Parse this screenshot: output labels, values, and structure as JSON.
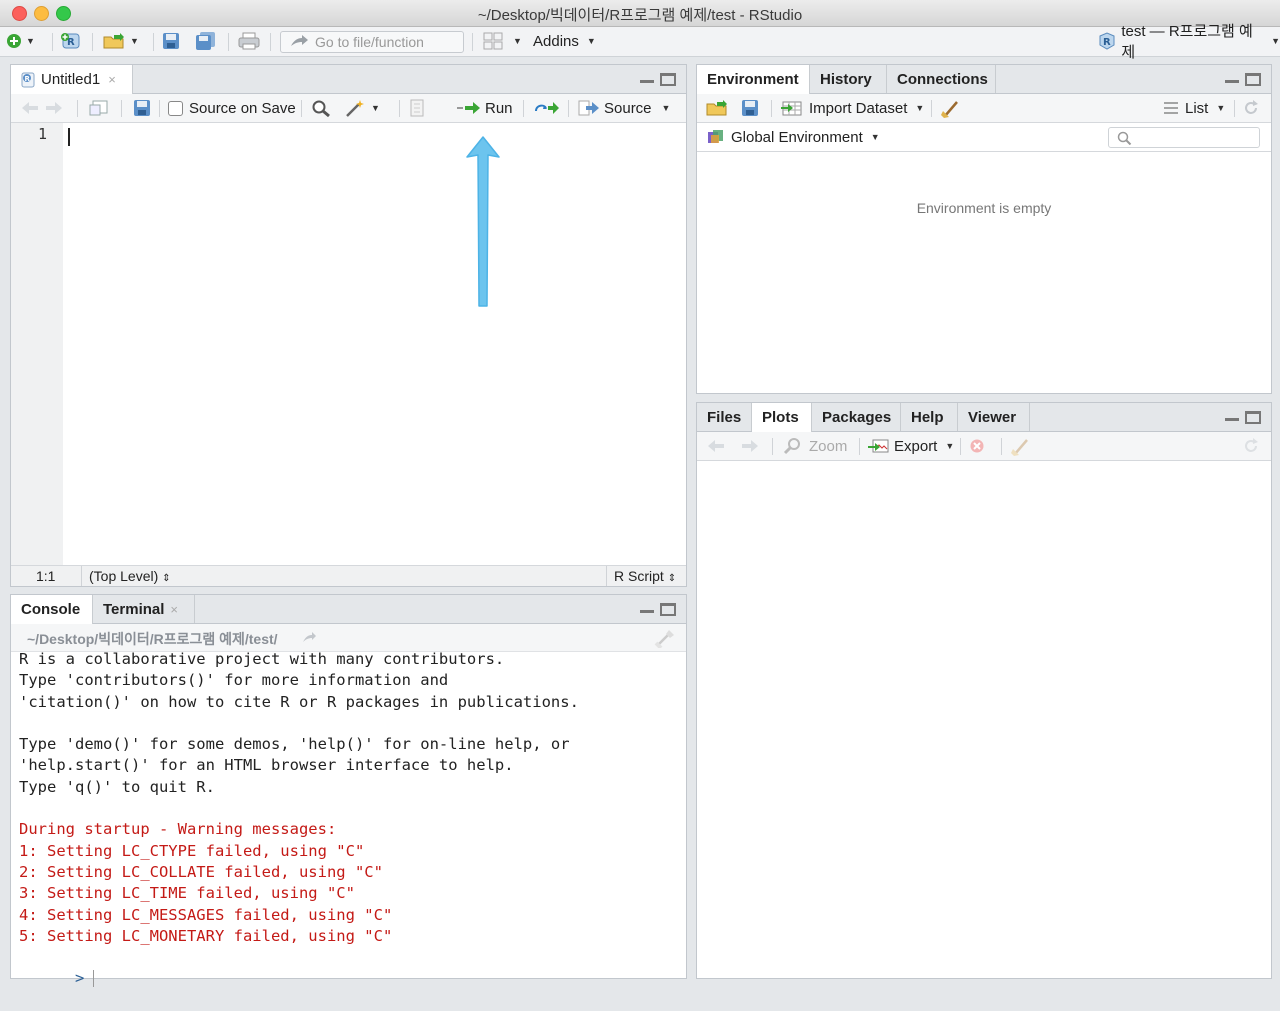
{
  "window": {
    "title": "~/Desktop/빅데이터/R프로그램 예제/test - RStudio"
  },
  "toolbar": {
    "goto_placeholder": "Go to file/function",
    "addins_label": "Addins",
    "project_label": "test — R프로그램 예제"
  },
  "editor": {
    "tab_label": "Untitled1",
    "source_on_save_label": "Source on Save",
    "run_label": "Run",
    "source_label": "Source",
    "line_number": "1",
    "status_position": "1:1",
    "status_scope": "(Top Level)",
    "status_filetype": "R Script"
  },
  "console": {
    "tabs": [
      "Console",
      "Terminal"
    ],
    "path": "~/Desktop/빅데이터/R프로그램 예제/test/",
    "lines": [
      "R is a collaborative project with many contributors.",
      "Type 'contributors()' for more information and",
      "'citation()' on how to cite R or R packages in publications.",
      "",
      "Type 'demo()' for some demos, 'help()' for on-line help, or",
      "'help.start()' for an HTML browser interface to help.",
      "Type 'q()' to quit R.",
      ""
    ],
    "warning_lines": [
      "During startup - Warning messages:",
      "1: Setting LC_CTYPE failed, using \"C\"",
      "2: Setting LC_COLLATE failed, using \"C\"",
      "3: Setting LC_TIME failed, using \"C\"",
      "4: Setting LC_MESSAGES failed, using \"C\"",
      "5: Setting LC_MONETARY failed, using \"C\""
    ],
    "prompt": ">"
  },
  "environment": {
    "tabs": [
      "Environment",
      "History",
      "Connections"
    ],
    "import_label": "Import Dataset",
    "list_label": "List",
    "scope_label": "Global Environment",
    "empty_text": "Environment is empty"
  },
  "files": {
    "tabs": [
      "Files",
      "Plots",
      "Packages",
      "Help",
      "Viewer"
    ],
    "zoom_label": "Zoom",
    "export_label": "Export"
  },
  "colors": {
    "accent_blue": "#5aa9e6",
    "warning_red": "#c41a16",
    "annotation_arrow": "#6cc4ee"
  }
}
